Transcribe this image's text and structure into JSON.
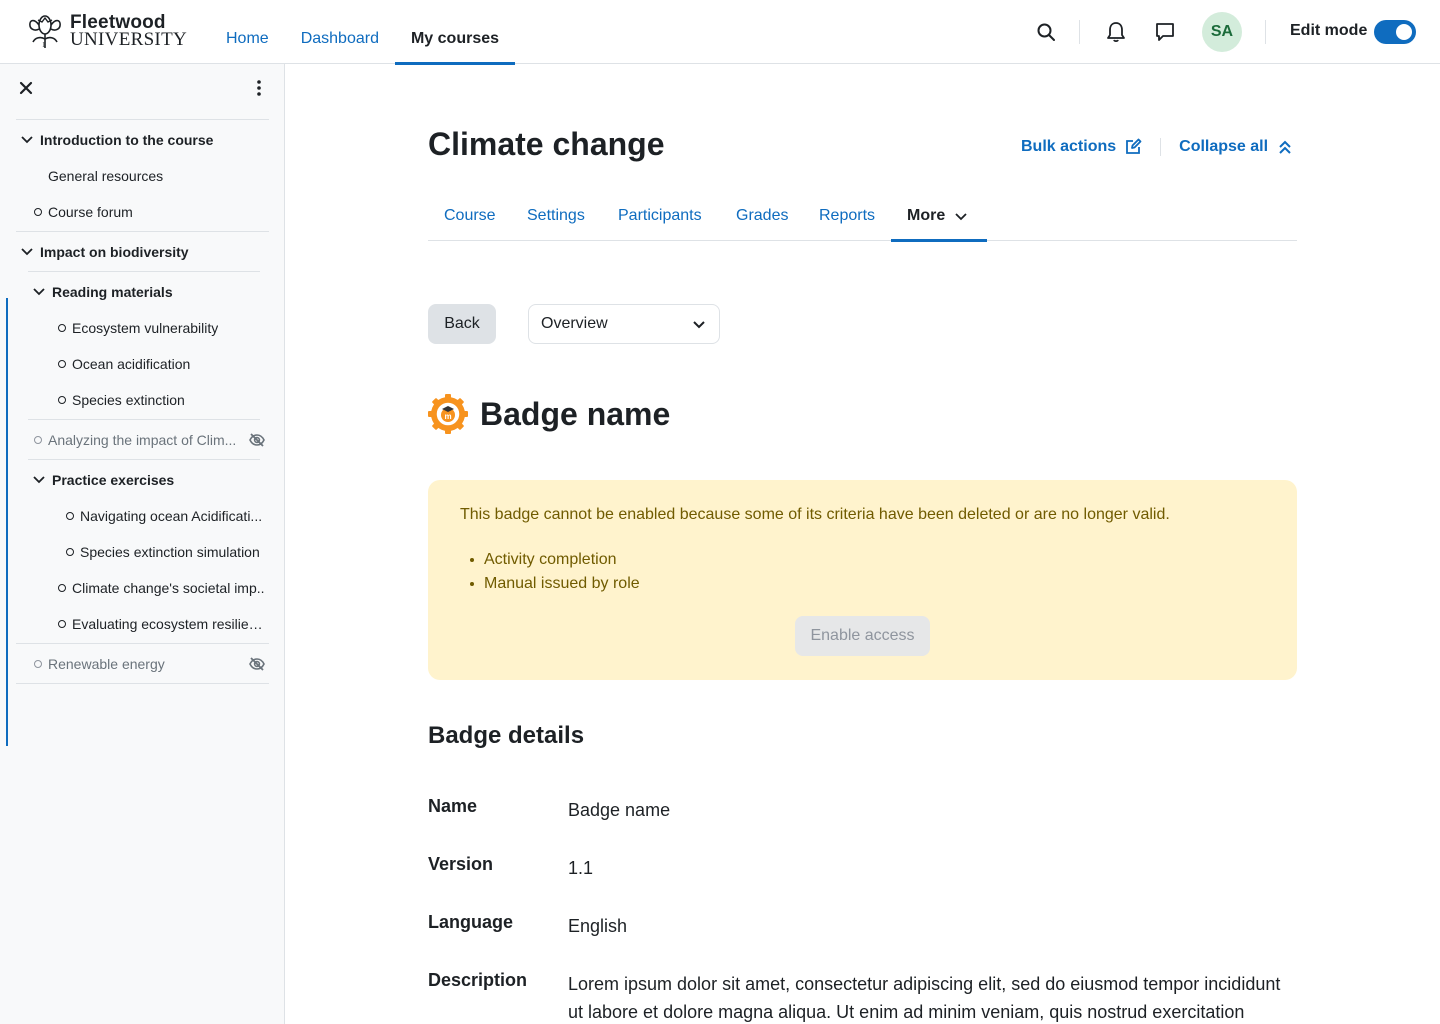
{
  "brand": {
    "line1": "Fleetwood",
    "line2": "UNIVERSITY"
  },
  "primary_nav": [
    "Home",
    "Dashboard",
    "My courses"
  ],
  "user": {
    "initials": "SA"
  },
  "edit_mode": {
    "label": "Edit mode",
    "enabled": true
  },
  "drawer": {
    "items": [
      {
        "label": "Introduction to the course",
        "kind": "section"
      },
      {
        "label": "General resources",
        "kind": "page"
      },
      {
        "label": "Course forum",
        "kind": "activity"
      },
      {
        "label": "Impact on biodiversity",
        "kind": "section"
      },
      {
        "label": "Reading materials",
        "kind": "subsection"
      },
      {
        "label": "Ecosystem vulnerability",
        "kind": "activity"
      },
      {
        "label": "Ocean acidification",
        "kind": "activity"
      },
      {
        "label": "Species extinction",
        "kind": "activity"
      },
      {
        "label": "Analyzing the impact of Clim...",
        "kind": "hidden-activity"
      },
      {
        "label": "Practice exercises",
        "kind": "subsection"
      },
      {
        "label": "Navigating ocean Acidificati...",
        "kind": "activity"
      },
      {
        "label": "Species extinction simulation",
        "kind": "activity"
      },
      {
        "label": "Climate change's societal imp..",
        "kind": "activity"
      },
      {
        "label": "Evaluating ecosystem resilien...",
        "kind": "activity"
      },
      {
        "label": "Renewable energy",
        "kind": "hidden-activity"
      }
    ]
  },
  "course": {
    "title": "Climate change",
    "bulk_actions": "Bulk actions",
    "collapse_all": "Collapse all"
  },
  "secondary_nav": [
    "Course",
    "Settings",
    "Participants",
    "Grades",
    "Reports",
    "More"
  ],
  "back_label": "Back",
  "select": {
    "value": "Overview"
  },
  "badge": {
    "name": "Badge name"
  },
  "alert": {
    "message": "This badge cannot be enabled because some of its criteria have been deleted or are no longer valid.",
    "items": [
      "Activity completion",
      "Manual issued by role"
    ],
    "button": "Enable access"
  },
  "details": {
    "title": "Badge details",
    "rows": [
      {
        "key": "Name",
        "value": "Badge name"
      },
      {
        "key": "Version",
        "value": "1.1"
      },
      {
        "key": "Language",
        "value": "English"
      },
      {
        "key": "Description",
        "value": "Lorem ipsum dolor sit amet, consectetur adipiscing elit, sed do eiusmod tempor incididunt ut labore et dolore magna aliqua. Ut enim ad minim veniam, quis nostrud exercitation"
      }
    ]
  },
  "colors": {
    "accent": "#0f6cbf",
    "alert_bg": "#fff3cd",
    "alert_text": "#705b00",
    "badge_orange": "#f7931e"
  }
}
